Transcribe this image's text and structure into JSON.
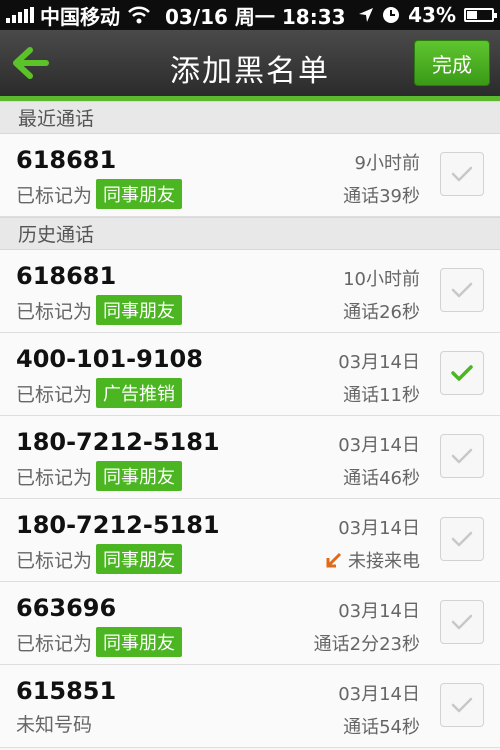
{
  "statusbar": {
    "carrier": "中国移动",
    "datetime": "03/16 周一 18:33",
    "battery": "43%",
    "battery_level": 0.43
  },
  "navbar": {
    "title": "添加黑名单",
    "done_label": "完成"
  },
  "colors": {
    "accent": "#4bb522",
    "navbar": "#3a3a3a",
    "missed": "#e06a1a"
  },
  "sections": [
    {
      "header": "最近通话",
      "rows": [
        {
          "number": "618681",
          "label_prefix": "已标记为",
          "tag": "同事朋友",
          "time": "9小时前",
          "duration": "通话39秒",
          "checked": false
        }
      ]
    },
    {
      "header": "历史通话",
      "rows": [
        {
          "number": "618681",
          "label_prefix": "已标记为",
          "tag": "同事朋友",
          "time": "10小时前",
          "duration": "通话26秒",
          "checked": false
        },
        {
          "number": "400-101-9108",
          "label_prefix": "已标记为",
          "tag": "广告推销",
          "time": "03月14日",
          "duration": "通话11秒",
          "checked": true
        },
        {
          "number": "180-7212-5181",
          "label_prefix": "已标记为",
          "tag": "同事朋友",
          "time": "03月14日",
          "duration": "通话46秒",
          "checked": false
        },
        {
          "number": "180-7212-5181",
          "label_prefix": "已标记为",
          "tag": "同事朋友",
          "time": "03月14日",
          "duration": "未接来电",
          "missed": true,
          "checked": false
        },
        {
          "number": "663696",
          "label_prefix": "已标记为",
          "tag": "同事朋友",
          "time": "03月14日",
          "duration": "通话2分23秒",
          "checked": false
        },
        {
          "number": "615851",
          "label_prefix": "未知号码",
          "tag": "",
          "time": "03月14日",
          "duration": "通话54秒",
          "checked": false
        }
      ]
    }
  ]
}
